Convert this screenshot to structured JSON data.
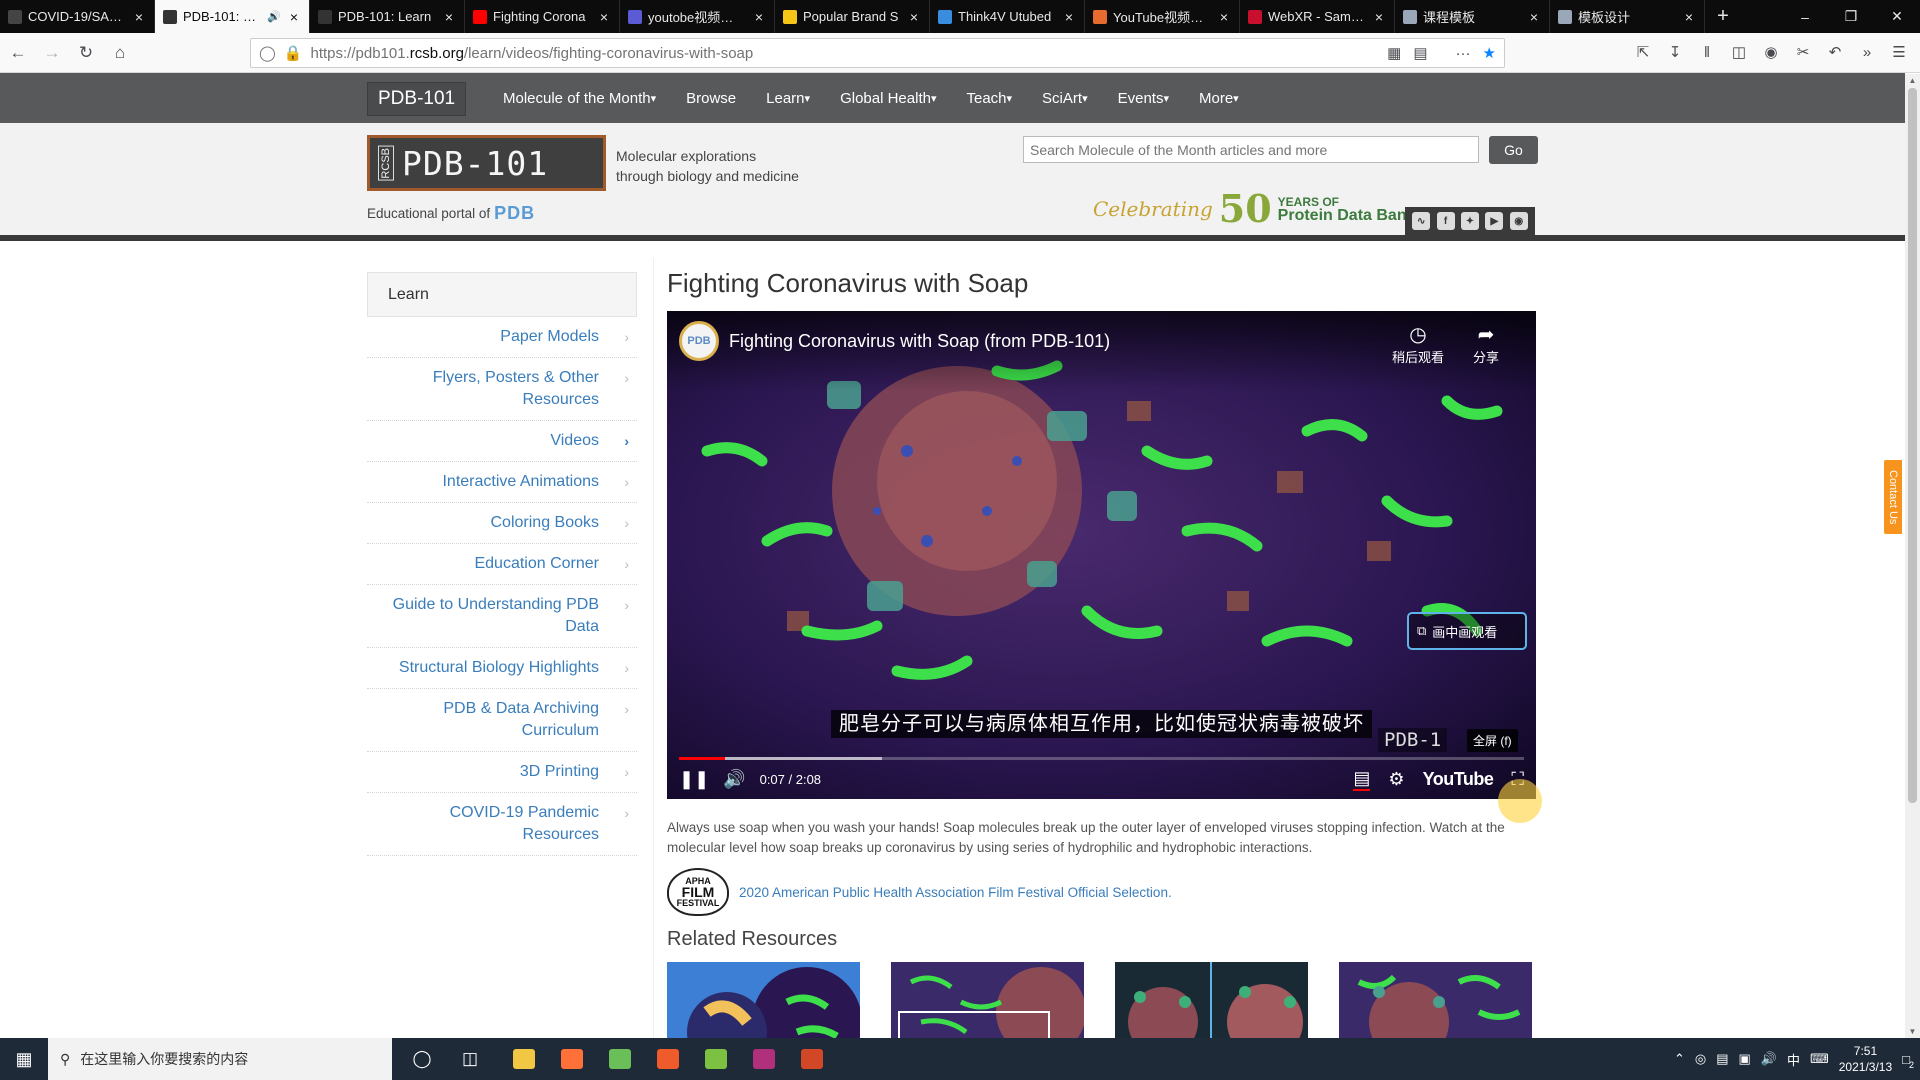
{
  "browser": {
    "tabs": [
      {
        "title": "COVID-19/SARS",
        "icon": "site-icon",
        "color": "#444444",
        "active": false
      },
      {
        "title": "PDB-101: Lea",
        "icon": "pdb-icon",
        "color": "#333333",
        "active": true,
        "audio": true
      },
      {
        "title": "PDB-101: Learn",
        "icon": "pdb-icon",
        "color": "#333333",
        "active": false
      },
      {
        "title": "Fighting Corona",
        "icon": "youtube-icon",
        "color": "#ff0000",
        "active": false
      },
      {
        "title": "youtobe视频下载",
        "icon": "site-icon",
        "color": "#5b5bd6",
        "active": false
      },
      {
        "title": "Popular Brand S",
        "icon": "smiley-icon",
        "color": "#f5c518",
        "active": false
      },
      {
        "title": "Think4V Utubed",
        "icon": "bird-icon",
        "color": "#3a8dde",
        "active": false
      },
      {
        "title": "YouTube视频下载",
        "icon": "colorful-icon",
        "color": "#e66b2e",
        "active": false
      },
      {
        "title": "WebXR - Sample",
        "icon": "shield-icon",
        "color": "#c8102e",
        "active": false
      },
      {
        "title": "课程模板",
        "icon": "doc-icon",
        "color": "#9aa7b8",
        "active": false
      },
      {
        "title": "模板设计",
        "icon": "doc-icon",
        "color": "#9aa7b8",
        "active": false
      }
    ],
    "new_tab": "+",
    "url_prefix": "https://pdb101.",
    "url_host": "rcsb.org",
    "url_path": "/learn/videos/fighting-coronavirus-with-soap"
  },
  "site": {
    "brand": "PDB-101",
    "menu": [
      "Molecule of the Month",
      "Browse",
      "Learn",
      "Global Health",
      "Teach",
      "SciArt",
      "Events",
      "More"
    ],
    "menu_has_caret": [
      true,
      false,
      true,
      true,
      true,
      true,
      true,
      true
    ],
    "logo_rcsb": "RCSB",
    "logo_text": "PDB-101",
    "tagline_1": "Molecular explorations",
    "tagline_2": "through biology and medicine",
    "portal_text": "Educational portal of",
    "portal_mark": "PDB",
    "search_placeholder": "Search Molecule of the Month articles and more",
    "go_label": "Go",
    "celebrating": "Celebrating",
    "fifty": "50",
    "years_of": "YEARS OF",
    "protein_data_bank": "Protein Data Bank",
    "social": [
      "rss-icon",
      "facebook-icon",
      "twitter-icon",
      "youtube-icon",
      "github-icon"
    ]
  },
  "sidebar": {
    "header": "Learn",
    "items": [
      {
        "label": "Paper Models",
        "active": false
      },
      {
        "label": "Flyers, Posters & Other Resources",
        "active": false
      },
      {
        "label": "Videos",
        "active": true
      },
      {
        "label": "Interactive Animations",
        "active": false
      },
      {
        "label": "Coloring Books",
        "active": false
      },
      {
        "label": "Education Corner",
        "active": false
      },
      {
        "label": "Guide to Understanding PDB Data",
        "active": false
      },
      {
        "label": "Structural Biology Highlights",
        "active": false
      },
      {
        "label": "PDB & Data Archiving Curriculum",
        "active": false
      },
      {
        "label": "3D Printing",
        "active": false
      },
      {
        "label": "COVID-19 Pandemic Resources",
        "active": false
      }
    ]
  },
  "main": {
    "title": "Fighting Coronavirus with Soap",
    "video": {
      "channel_logo": "PDB",
      "title": "Fighting Coronavirus with Soap (from PDB-101)",
      "watch_later": "稍后观看",
      "share": "分享",
      "pip": "画中画观看",
      "caption": "肥皂分子可以与病原体相互作用，比如使冠状病毒被破坏",
      "watermark": "PDB-1",
      "fullscreen_tip": "全屏 (f)",
      "time": "0:07 / 2:08",
      "played_fraction": 0.055,
      "buffered_fraction": 0.24,
      "youtube": "YouTube"
    },
    "description": "Always use soap when you wash your hands! Soap molecules break up the outer layer of enveloped viruses stopping infection. Watch at the molecular level how soap breaks up coronavirus by using series of hydrophilic and hydrophobic interactions.",
    "award_badge_top": "APHA",
    "award_badge_mid": "FILM",
    "award_badge_bottom": "FESTIVAL",
    "award_link": "2020 American Public Health Association Film Festival Official Selection.",
    "related_title": "Related Resources"
  },
  "contact": "Contact Us",
  "taskbar": {
    "search_placeholder": "在这里输入你要搜索的内容",
    "apps": [
      {
        "name": "file-explorer-icon",
        "color": "#f2c744"
      },
      {
        "name": "firefox-icon",
        "color": "#ff7139"
      },
      {
        "name": "app-leaf-icon",
        "color": "#6bbf59"
      },
      {
        "name": "app-x-icon",
        "color": "#ef5b2b"
      },
      {
        "name": "notepad-icon",
        "color": "#7dc142"
      },
      {
        "name": "app-media-icon",
        "color": "#b1307b"
      },
      {
        "name": "powerpoint-icon",
        "color": "#d24726"
      }
    ],
    "ime": "中",
    "time": "7:51",
    "date": "2021/3/13",
    "notification_count": "2"
  }
}
